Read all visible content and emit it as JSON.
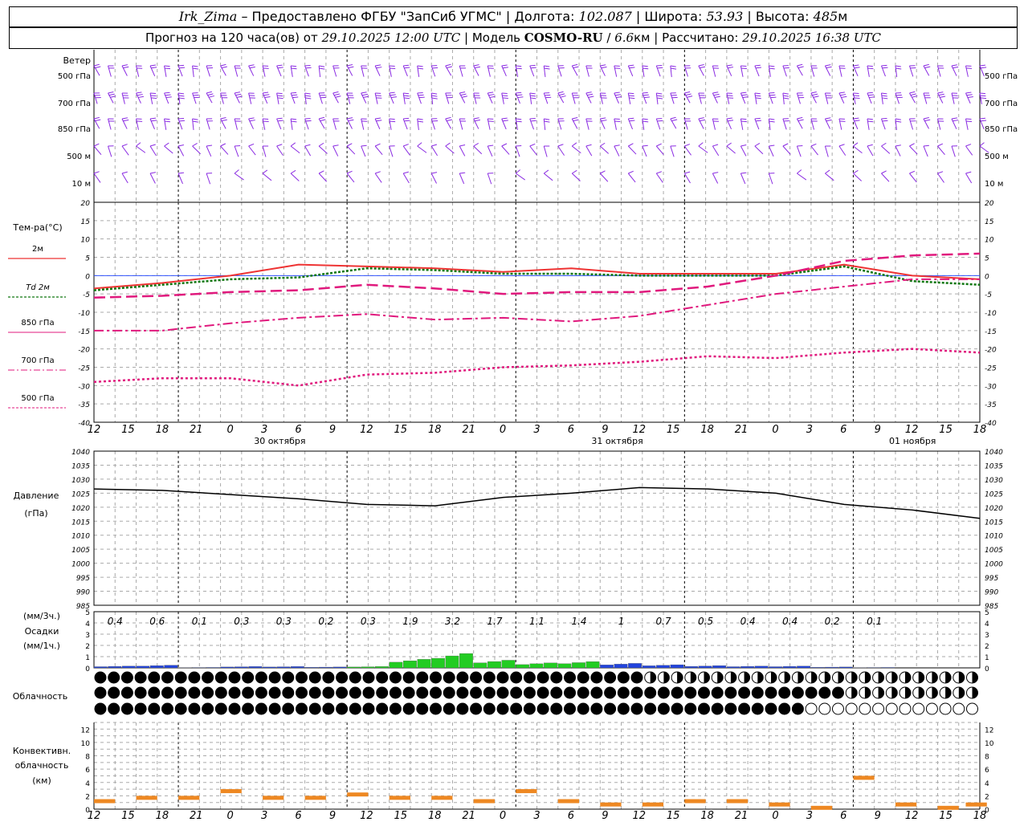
{
  "header": {
    "station": "Irk_Zima",
    "provider": "– Предоставлено ФГБУ \"ЗапСиб УГМС\"",
    "lon_label": "Долгота:",
    "lon_value": "102.087",
    "lat_label": "Широта:",
    "lat_value": "53.93",
    "alt_label": "Высота:",
    "alt_value": "485",
    "alt_unit": "м",
    "forecast_prefix": "Прогноз на 120 часа(ов) от",
    "forecast_start": "29.10.2025 12:00 UTC",
    "model_label": "Модель",
    "model_name": "COSMO-RU",
    "model_res": "6.6",
    "model_res_unit": "км",
    "computed_label": "Рассчитано:",
    "computed_time": "29.10.2025 16:38 UTC"
  },
  "colors": {
    "wind": "#8a2be2",
    "t2m": "#ee3333",
    "td2m": "#117711",
    "t850": "#e0197d",
    "grid": "#aaaaaa",
    "precip_rain": "#22cc22",
    "precip_snow": "#2244dd",
    "convective": "#ee8822"
  },
  "wind_panel": {
    "title": "Ветер",
    "levels_left": [
      "500 гПа",
      "700 гПа",
      "850 гПа",
      "500 м",
      "10 м"
    ],
    "levels_right": [
      "500 гПа",
      "700 гПа",
      "850 гПа",
      "500 м",
      "10 м"
    ]
  },
  "temperature_panel": {
    "title": "Тем-ра(°С)",
    "legend": [
      "2м",
      "Td 2м",
      "850 гПа",
      "700 гПа",
      "500 гПа"
    ],
    "ticks": [
      "20",
      "15",
      "10",
      "5",
      "0",
      "-5",
      "-10",
      "-15",
      "-20",
      "-25",
      "-30",
      "-35",
      "-40"
    ]
  },
  "time_axis": {
    "hours": [
      "12",
      "15",
      "18",
      "21",
      "0",
      "3",
      "6",
      "9",
      "12",
      "15",
      "18",
      "21",
      "0",
      "3",
      "6",
      "9",
      "12",
      "15",
      "18",
      "21",
      "0",
      "3",
      "6",
      "9",
      "12",
      "15",
      "18"
    ],
    "dates": [
      "30 октября",
      "31 октября",
      "01 ноября"
    ]
  },
  "pressure_panel": {
    "title": "Давление",
    "unit": "(гПа)",
    "ticks": [
      "1040",
      "1035",
      "1030",
      "1025",
      "1020",
      "1015",
      "1010",
      "1005",
      "1000",
      "995",
      "990",
      "985"
    ]
  },
  "precip_panel": {
    "unit_3h": "(мм/3ч.)",
    "title": "Осадки",
    "unit_1h": "(мм/1ч.)",
    "ticks": [
      "5",
      "4",
      "3",
      "2",
      "1",
      "0"
    ],
    "totals_3h": [
      "0.4",
      "0.6",
      "0.1",
      "0.3",
      "0.3",
      "0.2",
      "0.3",
      "1.9",
      "3.2",
      "1.7",
      "1.1",
      "1.4",
      "1",
      "0.7",
      "0.5",
      "0.4",
      "0.4",
      "0.2",
      "0.1"
    ]
  },
  "cloud_panel": {
    "title": "Облачность"
  },
  "convective_panel": {
    "title_line1": "Конвективн.",
    "title_line2": "облачность",
    "unit": "(км)",
    "ticks": [
      "12",
      "10",
      "8",
      "6",
      "4",
      "2",
      "0"
    ]
  },
  "chart_data": [
    {
      "type": "line",
      "title": "Тем-ра(°С)",
      "x": [
        "29.10 12",
        "29.10 18",
        "30.10 00",
        "30.10 06",
        "30.10 12",
        "30.10 18",
        "31.10 00",
        "31.10 06",
        "31.10 12",
        "31.10 18",
        "01.11 00",
        "01.11 06",
        "01.11 12",
        "01.11 18"
      ],
      "series": [
        {
          "name": "2м",
          "values": [
            -3.5,
            -2,
            0,
            3,
            2.5,
            2,
            1,
            2,
            0.5,
            0.5,
            0.5,
            3,
            0,
            -1
          ]
        },
        {
          "name": "Td 2м",
          "values": [
            -4,
            -2.5,
            -1,
            -0.5,
            2,
            1.5,
            0.5,
            0.5,
            0,
            0,
            0,
            2.5,
            -1.5,
            -2.5
          ]
        },
        {
          "name": "850 гПа",
          "values": [
            -6,
            -5.5,
            -4.5,
            -4,
            -2.5,
            -3.5,
            -5,
            -4.5,
            -4.5,
            -3,
            0,
            4,
            5.5,
            6
          ]
        },
        {
          "name": "700 гПа",
          "values": [
            -15,
            -15,
            -13,
            -11.5,
            -10.5,
            -12,
            -11.5,
            -12.5,
            -11,
            -8,
            -5,
            -3,
            -1,
            -1
          ]
        },
        {
          "name": "500 гПа",
          "values": [
            -29,
            -28,
            -28,
            -30,
            -27,
            -26.5,
            -25,
            -24.5,
            -23.5,
            -22,
            -22.5,
            -21,
            -20,
            -21
          ]
        }
      ],
      "ylim": [
        -40,
        20
      ]
    },
    {
      "type": "line",
      "title": "Давление",
      "x": [
        "29.10 12",
        "29.10 18",
        "30.10 00",
        "30.10 06",
        "30.10 12",
        "30.10 18",
        "31.10 00",
        "31.10 06",
        "31.10 12",
        "31.10 18",
        "01.11 00",
        "01.11 06",
        "01.11 12",
        "01.11 18"
      ],
      "series": [
        {
          "name": "Давление",
          "values": [
            1026.5,
            1026,
            1024.5,
            1023,
            1021,
            1020.5,
            1023.5,
            1025,
            1027,
            1026.5,
            1025,
            1021,
            1019,
            1016
          ]
        }
      ],
      "ylim": [
        985,
        1040
      ]
    },
    {
      "type": "bar",
      "title": "Осадки",
      "categories": [
        "29.10 15",
        "29.10 18",
        "29.10 21",
        "30.10 00",
        "30.10 03",
        "30.10 06",
        "30.10 09",
        "30.10 12",
        "30.10 15",
        "30.10 18",
        "30.10 21",
        "31.10 00",
        "31.10 03",
        "31.10 06",
        "31.10 09",
        "31.10 12",
        "31.10 15",
        "31.10 18",
        "31.10 21"
      ],
      "values": [
        0.4,
        0.6,
        0.1,
        0.3,
        0.3,
        0.2,
        0.3,
        1.9,
        3.2,
        1.7,
        1.1,
        1.4,
        1,
        0.7,
        0.5,
        0.4,
        0.4,
        0.2,
        0.1
      ],
      "ylim": [
        0,
        5
      ]
    },
    {
      "type": "bar",
      "title": "Конвективн. облачность",
      "categories": [
        "29.10 12",
        "29.10 15",
        "29.10 18",
        "29.10 21",
        "30.10 00",
        "30.10 03",
        "30.10 06",
        "30.10 09",
        "30.10 12",
        "30.10 15",
        "30.10 18",
        "30.10 21",
        "31.10 00",
        "31.10 03",
        "31.10 06",
        "31.10 09",
        "31.10 12",
        "31.10 15",
        "31.10 18",
        "31.10 21",
        "01.11 00",
        "01.11 06"
      ],
      "values": [
        1.5,
        2,
        2,
        3,
        2,
        2,
        2.5,
        2,
        2,
        1.5,
        3,
        1.5,
        1,
        1,
        1.5,
        1.5,
        1,
        0.5,
        5,
        1,
        0.5,
        1
      ],
      "ylim": [
        0,
        13
      ]
    }
  ]
}
